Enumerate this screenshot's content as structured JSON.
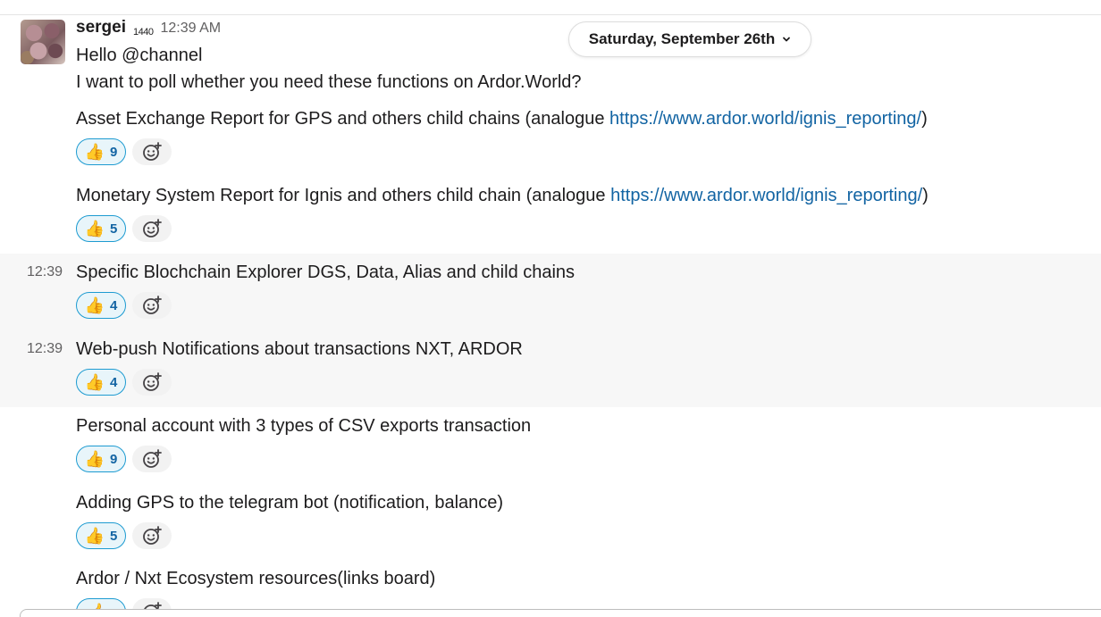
{
  "message": {
    "sender": "sergei",
    "sender_badge": "1440",
    "time": "12:39 AM",
    "lines": {
      "greeting": "Hello @channel",
      "intro": "I want to poll whether you need these functions on Ardor.World?"
    }
  },
  "date_divider": {
    "label": "Saturday, September 26th"
  },
  "link_url": "https://www.ardor.world/ignis_reporting/",
  "items": [
    {
      "prefix": "Asset Exchange Report for GPS and others child chains (analogue ",
      "link": "https://www.ardor.world/ignis_reporting/",
      "suffix": ")",
      "reaction_emoji": "👍",
      "reaction_count": "9",
      "gutter_time": ""
    },
    {
      "prefix": "Monetary System Report for Ignis and others child chain (analogue ",
      "link": "https://www.ardor.world/ignis_reporting/",
      "suffix": ")",
      "reaction_emoji": "👍",
      "reaction_count": "5",
      "gutter_time": ""
    },
    {
      "prefix": "Specific Blochchain Explorer DGS, Data, Alias and child chains",
      "link": "",
      "suffix": "",
      "reaction_emoji": "👍",
      "reaction_count": "4",
      "gutter_time": "12:39"
    },
    {
      "prefix": "Web-push Notifications about transactions NXT, ARDOR",
      "link": "",
      "suffix": "",
      "reaction_emoji": "👍",
      "reaction_count": "4",
      "gutter_time": "12:39"
    },
    {
      "prefix": "Personal account with 3 types of CSV exports transaction",
      "link": "",
      "suffix": "",
      "reaction_emoji": "👍",
      "reaction_count": "9",
      "gutter_time": ""
    },
    {
      "prefix": "Adding GPS to the telegram bot (notification, balance)",
      "link": "",
      "suffix": "",
      "reaction_emoji": "👍",
      "reaction_count": "5",
      "gutter_time": ""
    },
    {
      "prefix": "Ardor / Nxt Ecosystem resources(links board)",
      "link": "",
      "suffix": "",
      "reaction_emoji": "👍",
      "reaction_count": "",
      "gutter_time": ""
    }
  ],
  "icons": {
    "avatar": "user-avatar",
    "add_reaction": "add-reaction-icon",
    "chevron": "chevron-down-icon"
  },
  "colors": {
    "link": "#1264a3",
    "reaction_border": "#1d9bd1",
    "reaction_bg": "#e8f5fa",
    "hover_bg": "#f7f7f7"
  }
}
